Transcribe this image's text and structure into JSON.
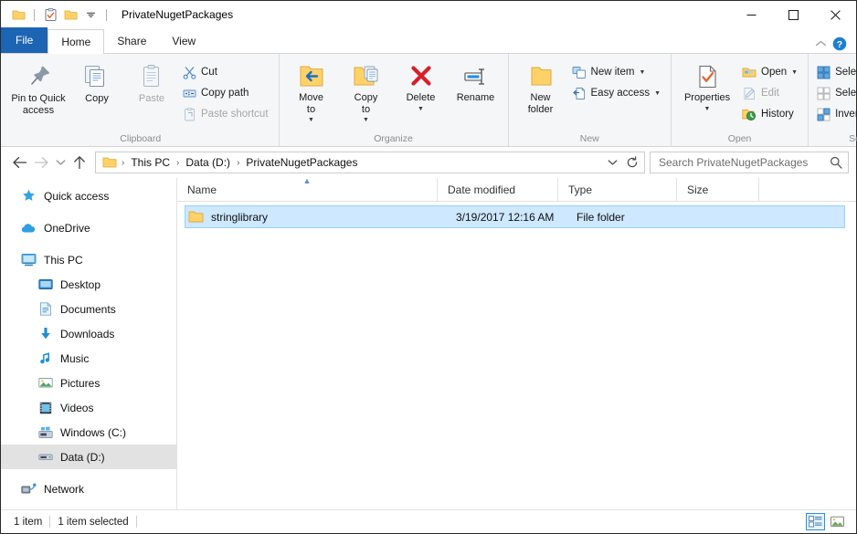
{
  "window": {
    "title": "PrivateNugetPackages",
    "quick_access_toolbar": [
      {
        "name": "properties-qat",
        "icon": "clipboard-check-icon"
      },
      {
        "name": "new-folder-qat",
        "icon": "folder-icon"
      },
      {
        "name": "customize-qat",
        "icon": "chevron-down-icon"
      }
    ],
    "controls": {
      "minimize": "–",
      "maximize": "☐",
      "close": "✕"
    }
  },
  "tabs": [
    {
      "label": "File",
      "state": "file-menu"
    },
    {
      "label": "Home",
      "state": "active"
    },
    {
      "label": "Share",
      "state": "inactive"
    },
    {
      "label": "View",
      "state": "inactive"
    }
  ],
  "tabbar_right": {
    "collapse_ribbon": "collapse-ribbon-icon",
    "help": "help-icon"
  },
  "ribbon": {
    "groups": [
      {
        "label": "Clipboard",
        "big_buttons": [
          {
            "label": "Pin to Quick\naccess",
            "icon": "pin-icon",
            "disabled": false
          },
          {
            "label": "Copy",
            "icon": "copy-icon",
            "disabled": false
          },
          {
            "label": "Paste",
            "icon": "paste-icon",
            "disabled": true
          }
        ],
        "small_buttons": [
          {
            "label": "Cut",
            "icon": "scissors-icon",
            "disabled": false
          },
          {
            "label": "Copy path",
            "icon": "copy-path-icon",
            "disabled": false
          },
          {
            "label": "Paste shortcut",
            "icon": "paste-shortcut-icon",
            "disabled": true
          }
        ]
      },
      {
        "label": "Organize",
        "big_buttons": [
          {
            "label": "Move\nto",
            "icon": "move-to-icon",
            "disabled": false,
            "caret": true
          },
          {
            "label": "Copy\nto",
            "icon": "copy-to-icon",
            "disabled": false,
            "caret": true
          },
          {
            "label": "Delete",
            "icon": "delete-icon",
            "disabled": false,
            "caret": true
          },
          {
            "label": "Rename",
            "icon": "rename-icon",
            "disabled": false
          }
        ],
        "small_buttons": []
      },
      {
        "label": "New",
        "big_buttons": [
          {
            "label": "New\nfolder",
            "icon": "new-folder-icon",
            "disabled": false
          }
        ],
        "small_buttons": [
          {
            "label": "New item",
            "icon": "new-item-icon",
            "disabled": false,
            "caret": true
          },
          {
            "label": "Easy access",
            "icon": "easy-access-icon",
            "disabled": false,
            "caret": true
          }
        ]
      },
      {
        "label": "Open",
        "big_buttons": [
          {
            "label": "Properties",
            "icon": "properties-icon",
            "disabled": false,
            "caret": true
          }
        ],
        "small_buttons": [
          {
            "label": "Open",
            "icon": "open-icon",
            "disabled": false,
            "caret": true
          },
          {
            "label": "Edit",
            "icon": "edit-icon",
            "disabled": true
          },
          {
            "label": "History",
            "icon": "history-icon",
            "disabled": false
          }
        ]
      },
      {
        "label": "Select",
        "big_buttons": [],
        "small_buttons": [
          {
            "label": "Select all",
            "icon": "select-all-icon",
            "disabled": false
          },
          {
            "label": "Select none",
            "icon": "select-none-icon",
            "disabled": false
          },
          {
            "label": "Invert selection",
            "icon": "invert-selection-icon",
            "disabled": false
          }
        ]
      }
    ]
  },
  "address_bar": {
    "back": {
      "name": "back-button",
      "icon": "arrow-left-icon",
      "enabled": true
    },
    "forward": {
      "name": "forward-button",
      "icon": "arrow-right-icon",
      "enabled": false
    },
    "recent": {
      "name": "recent-locations-button",
      "icon": "chevron-down-icon",
      "enabled": true
    },
    "up": {
      "name": "up-button",
      "icon": "arrow-up-icon",
      "enabled": true
    },
    "breadcrumbs": [
      "This PC",
      "Data (D:)",
      "PrivateNugetPackages"
    ],
    "separator": "›",
    "dropdown": {
      "name": "address-dropdown",
      "icon": "chevron-down-icon"
    },
    "refresh": {
      "name": "refresh-button",
      "icon": "refresh-icon"
    }
  },
  "search": {
    "placeholder": "Search PrivateNugetPackages",
    "value": "",
    "icon": "search-icon"
  },
  "nav_pane": {
    "items": [
      {
        "label": "Quick access",
        "icon": "star-icon",
        "level": 0,
        "selected": false
      },
      {
        "label": "OneDrive",
        "icon": "cloud-icon",
        "level": 0,
        "selected": false
      },
      {
        "label": "This PC",
        "icon": "monitor-icon",
        "level": 0,
        "selected": false
      },
      {
        "label": "Desktop",
        "icon": "desktop-icon",
        "level": 1,
        "selected": false
      },
      {
        "label": "Documents",
        "icon": "documents-icon",
        "level": 1,
        "selected": false
      },
      {
        "label": "Downloads",
        "icon": "download-icon",
        "level": 1,
        "selected": false
      },
      {
        "label": "Music",
        "icon": "music-icon",
        "level": 1,
        "selected": false
      },
      {
        "label": "Pictures",
        "icon": "pictures-icon",
        "level": 1,
        "selected": false
      },
      {
        "label": "Videos",
        "icon": "videos-icon",
        "level": 1,
        "selected": false
      },
      {
        "label": "Windows (C:)",
        "icon": "windows-drive-icon",
        "level": 1,
        "selected": false
      },
      {
        "label": "Data (D:)",
        "icon": "drive-icon",
        "level": 1,
        "selected": true
      },
      {
        "label": "Network",
        "icon": "network-icon",
        "level": 0,
        "selected": false
      }
    ]
  },
  "file_list": {
    "columns": [
      {
        "label": "Name",
        "sort": "ascending"
      },
      {
        "label": "Date modified",
        "sort": ""
      },
      {
        "label": "Type",
        "sort": ""
      },
      {
        "label": "Size",
        "sort": ""
      }
    ],
    "rows": [
      {
        "name": "stringlibrary",
        "date_modified": "3/19/2017 12:16 AM",
        "type": "File folder",
        "size": "",
        "icon": "folder-icon",
        "selected": true
      }
    ]
  },
  "status_bar": {
    "item_count": "1 item",
    "selection": "1 item selected",
    "views": [
      {
        "name": "details-view-button",
        "icon": "details-view-icon",
        "active": true
      },
      {
        "name": "large-icons-view-button",
        "icon": "large-icons-view-icon",
        "active": false
      }
    ]
  },
  "colors": {
    "file_tab": "#1c64b4",
    "selection": "#cde8ff",
    "selection_border": "#99d1ff",
    "nav_selection": "#e2e2e2",
    "ribbon_bg": "#f5f6f7",
    "folder_yellow": "#ffd268",
    "accent_blue": "#2a8fe0"
  }
}
